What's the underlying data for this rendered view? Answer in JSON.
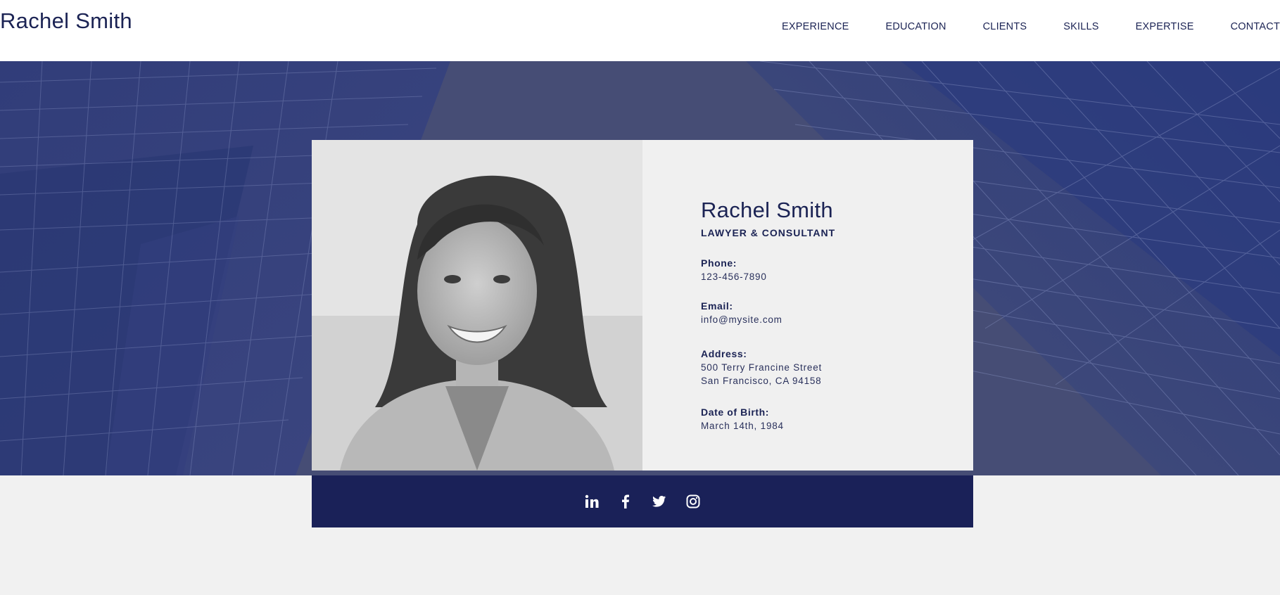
{
  "header": {
    "site_title": "Rachel Smith",
    "nav": [
      {
        "label": "EXPERIENCE"
      },
      {
        "label": "EDUCATION"
      },
      {
        "label": "CLIENTS"
      },
      {
        "label": "SKILLS"
      },
      {
        "label": "EXPERTISE"
      },
      {
        "label": "CONTACT"
      }
    ]
  },
  "profile": {
    "name": "Rachel Smith",
    "role": "LAWYER & CONSULTANT",
    "phone_label": "Phone:",
    "phone": "123-456-7890",
    "email_label": "Email:",
    "email": "info@mysite.com",
    "address_label": "Address:",
    "address_line1": "500 Terry Francine Street",
    "address_line2": "San Francisco, CA 94158",
    "dob_label": "Date of Birth:",
    "dob": "March 14th, 1984"
  },
  "social": [
    {
      "icon": "linkedin-icon"
    },
    {
      "icon": "facebook-icon"
    },
    {
      "icon": "twitter-icon"
    },
    {
      "icon": "instagram-icon"
    }
  ],
  "colors": {
    "navy": "#1b2354",
    "hero_bg": "#464d75",
    "social_bar": "#1a2158",
    "card_bg": "#f0f0f0",
    "page_bg": "#f1f1f1"
  }
}
